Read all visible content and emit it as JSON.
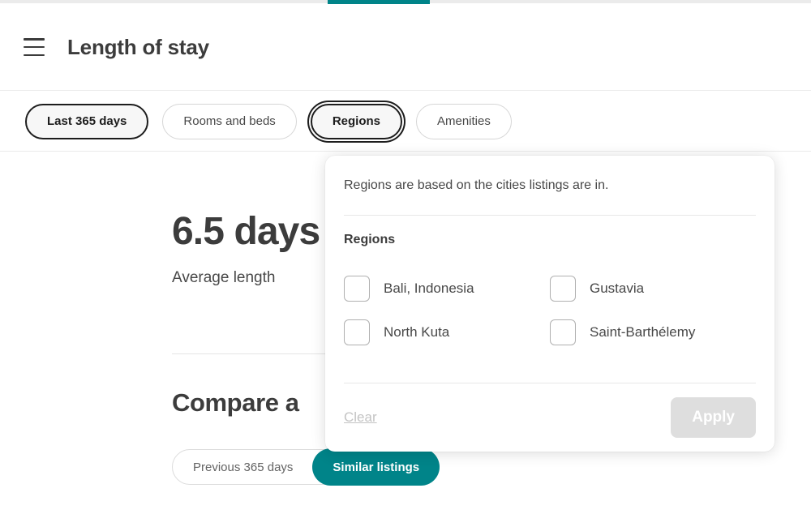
{
  "top_indicator": {
    "color": "#008489"
  },
  "header": {
    "menu_icon": "hamburger-icon",
    "title": "Length of stay"
  },
  "filters": {
    "pills": [
      {
        "label": "Last 365 days",
        "state": "selected"
      },
      {
        "label": "Rooms and beds",
        "state": "default"
      },
      {
        "label": "Regions",
        "state": "focused"
      },
      {
        "label": "Amenities",
        "state": "default"
      }
    ]
  },
  "main": {
    "stat_value": "6.5 days",
    "stat_label": "Average length",
    "compare_title": "Compare a",
    "comparison": {
      "options": [
        {
          "label": "Previous 365 days",
          "active": false
        },
        {
          "label": "Similar listings",
          "active": true
        }
      ],
      "active_color": "#008489"
    }
  },
  "popover": {
    "description": "Regions are based on the cities listings are in.",
    "group_title": "Regions",
    "options": [
      {
        "label": "Bali, Indonesia",
        "checked": false
      },
      {
        "label": "Gustavia",
        "checked": false
      },
      {
        "label": "North Kuta",
        "checked": false
      },
      {
        "label": "Saint-Barthélemy",
        "checked": false
      }
    ],
    "clear_label": "Clear",
    "apply_label": "Apply",
    "apply_disabled": true
  }
}
